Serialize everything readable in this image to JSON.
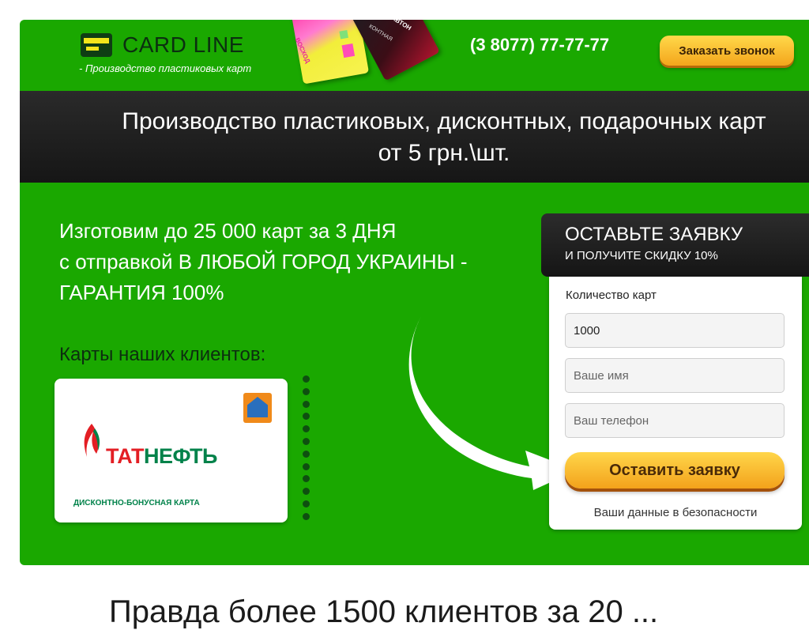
{
  "header": {
    "logo_title": "CARD LINE",
    "logo_subtitle": "- Производство пластиковых карт",
    "phone": "(3 8077) 77-77-77",
    "call_button": "Заказать звонок",
    "card_texts": {
      "card1": "ВОСХОД",
      "card2_brand": "АВТОН",
      "card2_label": "КОНТНАЯ"
    }
  },
  "banner": {
    "line1": "Производство пластиковых, дисконтных, подарочных карт",
    "line2": "от 5 грн.\\шт."
  },
  "promo": {
    "line1": "Изготовим до 25 000 карт за 3 ДНЯ",
    "line2": "с отправкой В ЛЮБОЙ ГОРОД УКРАИНЫ -",
    "line3": "ГАРАНТИЯ 100%"
  },
  "clients": {
    "label": "Карты наших клиентов:",
    "card": {
      "brand_red": "ТАТ",
      "brand_green": "НЕФТЬ",
      "caption": "ДИСКОНТНО-БОНУСНАЯ КАРТА"
    },
    "slider_dots": 12
  },
  "form": {
    "title": "ОСТАВЬТЕ ЗАЯВКУ",
    "subtitle": "И ПОЛУЧИТЕ СКИДКУ 10%",
    "quantity_label": "Количество карт",
    "quantity_value": "1000",
    "name_placeholder": "Ваше имя",
    "phone_placeholder": "Ваш телефон",
    "submit_label": "Оставить заявку",
    "security_note": "Ваши данные в безопасности"
  },
  "footer": {
    "headline_partial": "Правда более 1500 клиентов за 20 ..."
  },
  "colors": {
    "page_green": "#1aa800",
    "band_dark": "#1e1e1e",
    "button_orange": "#f4a51c",
    "logo_dark_green": "#0b2f10"
  }
}
